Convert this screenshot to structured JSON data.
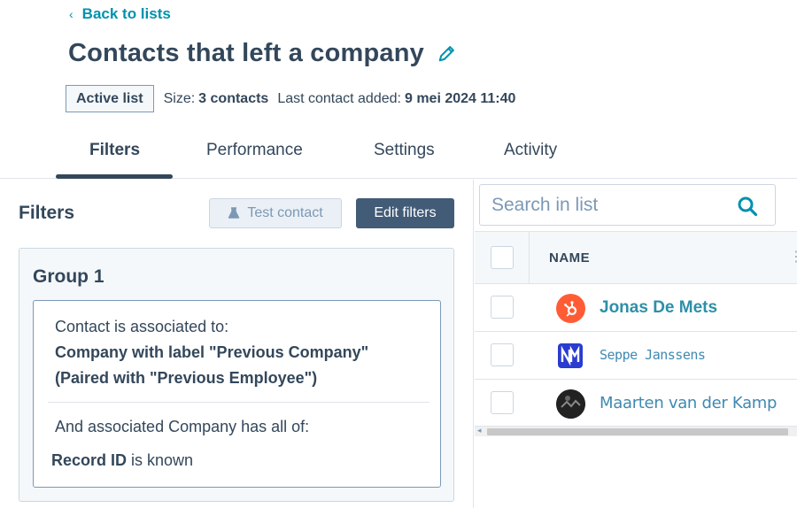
{
  "header": {
    "back_label": "Back to lists",
    "title": "Contacts that left a company",
    "status_badge": "Active list",
    "size_label": "Size:",
    "size_value": "3 contacts",
    "last_added_label": "Last contact added:",
    "last_added_value": "9 mei 2024 11:40"
  },
  "tabs": [
    {
      "label": "Filters",
      "active": true
    },
    {
      "label": "Performance",
      "active": false
    },
    {
      "label": "Settings",
      "active": false
    },
    {
      "label": "Activity",
      "active": false
    }
  ],
  "filters_panel": {
    "heading": "Filters",
    "test_contact_label": "Test contact",
    "edit_filters_label": "Edit filters",
    "group": {
      "title": "Group 1",
      "line1": "Contact is associated to:",
      "line2": "Company with label \"Previous Company\"",
      "line3": "(Paired with \"Previous Employee\")",
      "line4": "And associated Company has all of:",
      "record_bold": "Record ID",
      "record_rest": " is known"
    }
  },
  "list_panel": {
    "search_placeholder": "Search in list",
    "column_name": "NAME",
    "rows": [
      {
        "name": "Jonas De Mets",
        "avatar_icon": "hubspot-sprocket-icon"
      },
      {
        "name": "Seppe Janssens",
        "avatar_icon": "nm-logo-icon"
      },
      {
        "name": "Maarten van der Kamp",
        "avatar_icon": "dark-photo-icon"
      }
    ]
  },
  "colors": {
    "accent_link": "#0091ae",
    "primary_button": "#425b76",
    "hubspot_orange": "#ff5c35",
    "text": "#33475b"
  }
}
